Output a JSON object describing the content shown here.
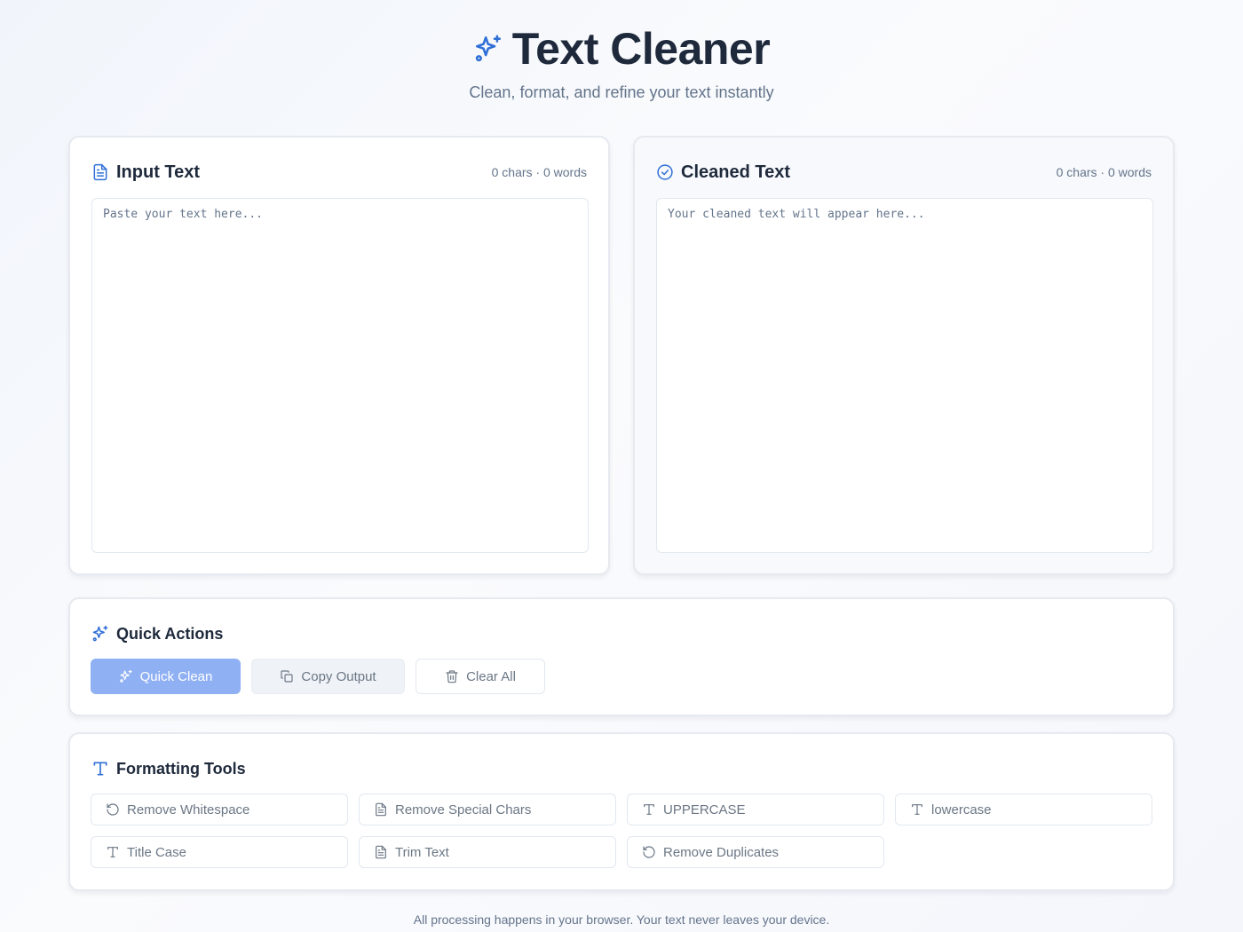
{
  "header": {
    "title": "Text Cleaner",
    "subtitle": "Clean, format, and refine your text instantly"
  },
  "input_panel": {
    "title": "Input Text",
    "counts": "0 chars · 0 words",
    "placeholder": "Paste your text here...",
    "value": ""
  },
  "output_panel": {
    "title": "Cleaned Text",
    "counts": "0 chars · 0 words",
    "placeholder": "Your cleaned text will appear here...",
    "value": ""
  },
  "quick_actions": {
    "title": "Quick Actions",
    "buttons": [
      {
        "label": "Quick Clean",
        "icon": "sparkles-icon"
      },
      {
        "label": "Copy Output",
        "icon": "copy-icon"
      },
      {
        "label": "Clear All",
        "icon": "trash-icon"
      }
    ]
  },
  "formatting_tools": {
    "title": "Formatting Tools",
    "tools": [
      {
        "label": "Remove Whitespace",
        "icon": "rotate-ccw-icon"
      },
      {
        "label": "Remove Special Chars",
        "icon": "file-text-icon"
      },
      {
        "label": "UPPERCASE",
        "icon": "type-icon"
      },
      {
        "label": "lowercase",
        "icon": "type-icon"
      },
      {
        "label": "Title Case",
        "icon": "type-icon"
      },
      {
        "label": "Trim Text",
        "icon": "file-text-icon"
      },
      {
        "label": "Remove Duplicates",
        "icon": "rotate-ccw-icon"
      }
    ]
  },
  "footer": {
    "text": "All processing happens in your browser. Your text never leaves your device."
  },
  "colors": {
    "accent": "#2f6fd6",
    "primary_button": "#8fb0f3",
    "heading": "#1e293b",
    "muted": "#64748b"
  }
}
